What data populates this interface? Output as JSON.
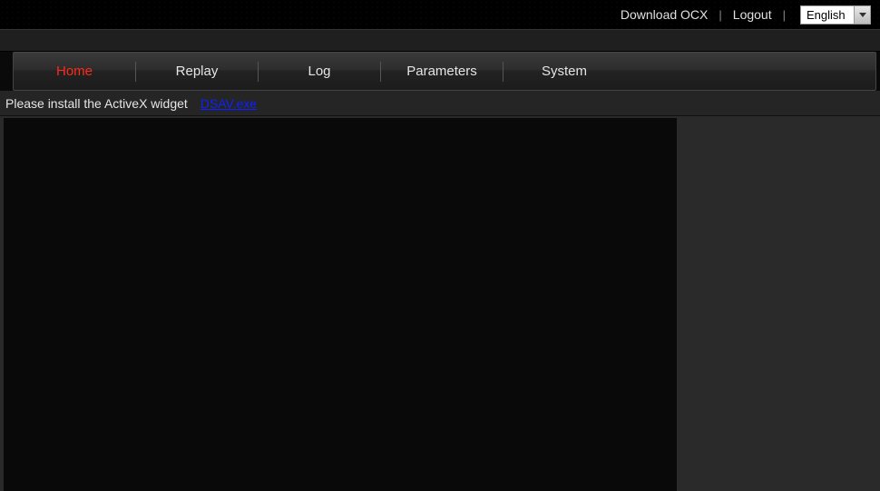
{
  "topbar": {
    "download_label": "Download OCX",
    "logout_label": "Logout",
    "language_selected": "English"
  },
  "nav": {
    "items": [
      {
        "label": "Home",
        "active": true
      },
      {
        "label": "Replay",
        "active": false
      },
      {
        "label": "Log",
        "active": false
      },
      {
        "label": "Parameters",
        "active": false
      },
      {
        "label": "System",
        "active": false
      }
    ]
  },
  "install": {
    "message": "Please install the ActiveX widget",
    "link_label": "DSAV.exe"
  }
}
